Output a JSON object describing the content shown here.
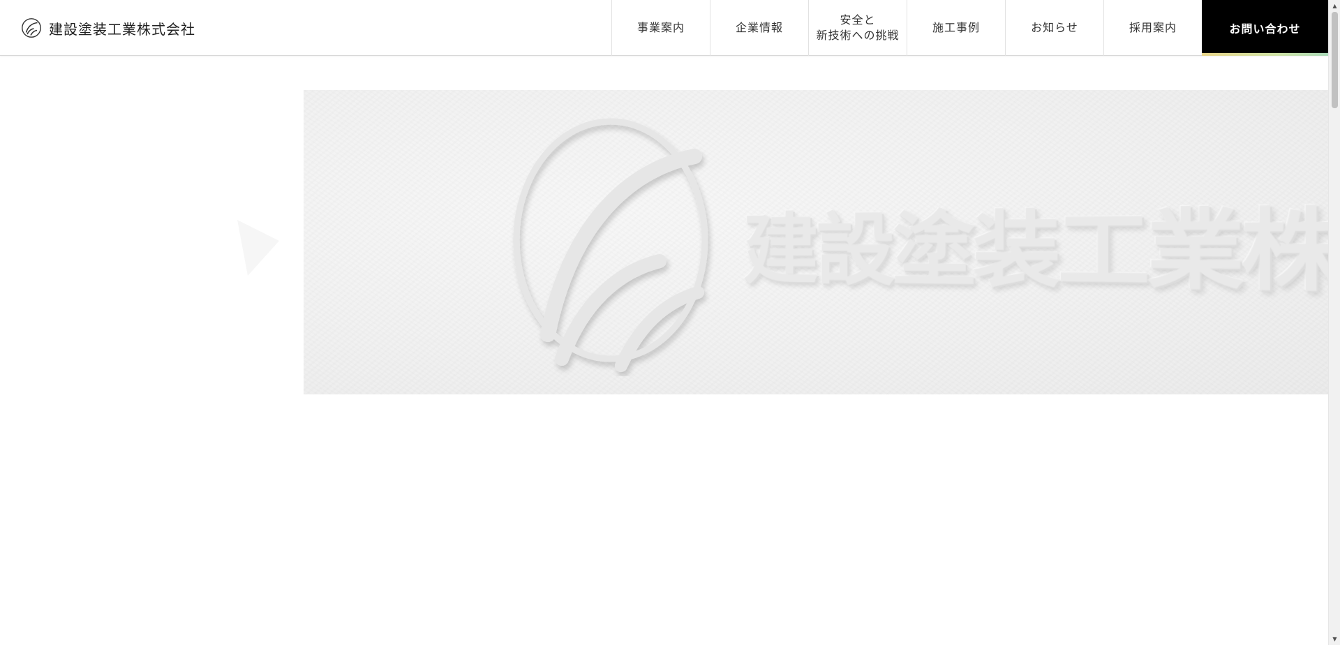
{
  "header": {
    "brand_name": "建設塗装工業株式会社",
    "nav": [
      {
        "label": "事業案内"
      },
      {
        "label": "企業情報"
      },
      {
        "label_line1": "安全と",
        "label_line2": "新技術への挑戦"
      },
      {
        "label": "施工事例"
      },
      {
        "label": "お知らせ"
      },
      {
        "label": "採用案内"
      }
    ],
    "contact_label": "お問い合わせ"
  },
  "hero": {
    "sign_text": "建設塗装工業株式会社"
  },
  "icons": {
    "brand": "company-logo-icon",
    "scroll_up": "scroll-up-arrow-icon",
    "scroll_down": "scroll-down-arrow-icon"
  },
  "colors": {
    "header_bg": "#ffffff",
    "contact_bg": "#000000",
    "contact_text": "#ffffff",
    "accent_gradient": [
      "#e8d58a",
      "#cfe3a6",
      "#a9d9b8"
    ],
    "hero_bg": "#f1f1f1"
  }
}
